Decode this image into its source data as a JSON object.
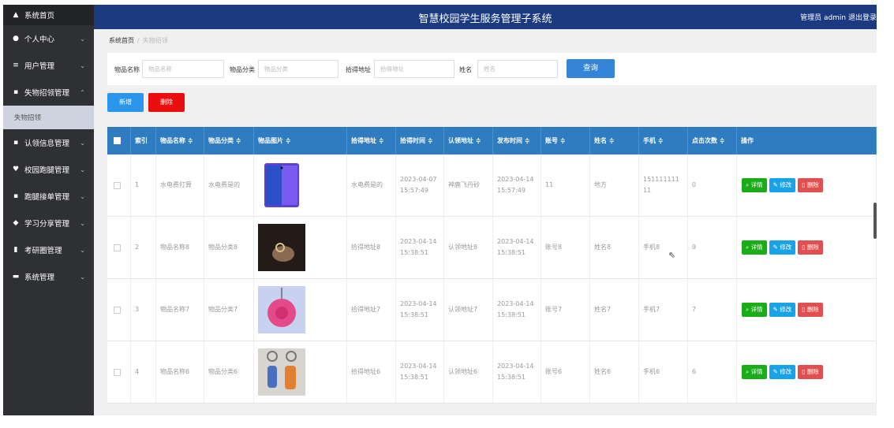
{
  "app": {
    "title": "智慧校园学生服务管理子系统",
    "user": "管理员 admin  退出登录"
  },
  "sidebar": {
    "items": [
      {
        "label": "系统首页",
        "icon": "home-icon",
        "glyph": "▲"
      },
      {
        "label": "个人中心",
        "icon": "user-icon",
        "glyph": "●",
        "chevron": true
      },
      {
        "label": "用户管理",
        "icon": "list-icon",
        "glyph": "≡",
        "chevron": true
      },
      {
        "label": "失物招领管理",
        "icon": "grid-icon",
        "glyph": "▪",
        "chevron": true,
        "open": true
      },
      {
        "label": "失物招领",
        "sub": true
      },
      {
        "label": "认领信息管理",
        "icon": "grid-icon",
        "glyph": "▪",
        "chevron": true
      },
      {
        "label": "校园跑腿管理",
        "icon": "cup-icon",
        "glyph": "♥",
        "chevron": true
      },
      {
        "label": "跑腿接单管理",
        "icon": "grid-icon",
        "glyph": "▪",
        "chevron": true
      },
      {
        "label": "学习分享管理",
        "icon": "thumb-icon",
        "glyph": "◆",
        "chevron": true
      },
      {
        "label": "考研圈管理",
        "icon": "bar-chart-icon",
        "glyph": "▮",
        "chevron": true
      },
      {
        "label": "系统管理",
        "icon": "monitor-icon",
        "glyph": "▬",
        "chevron": true
      }
    ]
  },
  "breadcrumb": {
    "home": "系统首页",
    "current": "失物招领"
  },
  "search": {
    "fields": [
      {
        "label": "物品名称",
        "placeholder": "物品名称"
      },
      {
        "label": "物品分类",
        "placeholder": "物品分类"
      },
      {
        "label": "拾得地址",
        "placeholder": "拾得地址"
      },
      {
        "label": "姓名",
        "placeholder": "姓名"
      }
    ],
    "query_label": "查询"
  },
  "actions": {
    "add_label": "新增",
    "delete_label": "删除"
  },
  "table": {
    "columns": [
      "索引",
      "物品名称 ≑",
      "物品分类 ≑",
      "物品图片 ≑",
      "拾得地址 ≑",
      "拾得时间 ≑",
      "认领地址 ≑",
      "发布时间 ≑",
      "账号 ≑",
      "姓名 ≑",
      "手机 ≑",
      "点击次数 ≑",
      "操作"
    ],
    "row_actions": {
      "detail": "详情",
      "edit": "修改",
      "delete": "删除"
    },
    "rows": [
      {
        "index": "1",
        "name": "水电费打算",
        "category": "水电费是的",
        "image": "phone",
        "found_addr": "水电费是的",
        "found_time": "2023-04-07\n15:57:49",
        "claim_addr": "神鹿飞丹砂",
        "pub_time": "2023-04-14\n15:57:49",
        "account": "11",
        "person": "地方",
        "phone": "151111111\n11",
        "clicks": "0"
      },
      {
        "index": "2",
        "name": "物品名称8",
        "category": "物品分类8",
        "image": "ring",
        "found_addr": "拾得地址8",
        "found_time": "2023-04-14\n15:38:51",
        "claim_addr": "认领地址8",
        "pub_time": "2023-04-14\n15:38:51",
        "account": "账号8",
        "person": "姓名8",
        "phone": "手机8",
        "clicks": "9"
      },
      {
        "index": "3",
        "name": "物品名称7",
        "category": "物品分类7",
        "image": "tag",
        "found_addr": "拾得地址7",
        "found_time": "2023-04-14\n15:38:51",
        "claim_addr": "认领地址7",
        "pub_time": "2023-04-14\n15:38:51",
        "account": "账号7",
        "person": "姓名7",
        "phone": "手机7",
        "clicks": "7"
      },
      {
        "index": "4",
        "name": "物品名称6",
        "category": "物品分类6",
        "image": "keychain",
        "found_addr": "拾得地址6",
        "found_time": "2023-04-14\n15:38:51",
        "claim_addr": "认领地址6",
        "pub_time": "2023-04-14\n15:38:51",
        "account": "账号6",
        "person": "姓名6",
        "phone": "手机6",
        "clicks": "6"
      }
    ]
  }
}
